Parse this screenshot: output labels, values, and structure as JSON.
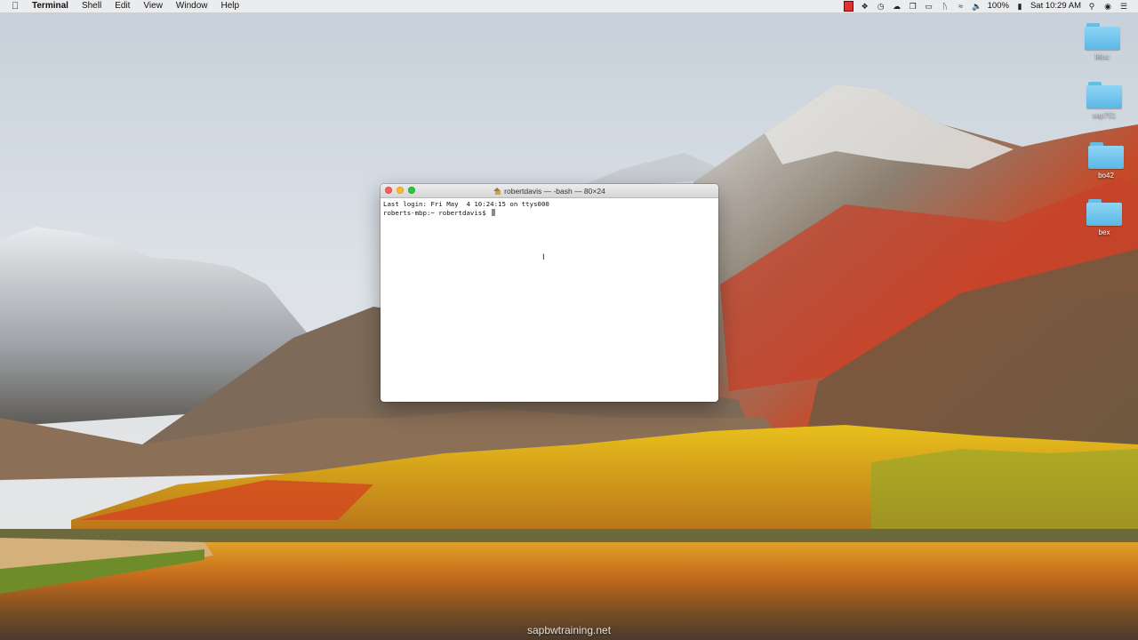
{
  "menubar": {
    "apple": "",
    "app_name": "Terminal",
    "menus": [
      "Shell",
      "Edit",
      "View",
      "Window",
      "Help"
    ],
    "battery_percent": "100%",
    "datetime": "Sat 10:29 AM",
    "icons": [
      "red-status-icon",
      "dropbox-icon",
      "time-machine-icon",
      "creative-cloud-icon",
      "screen-mirror-icon",
      "airplay-icon",
      "bluetooth-icon",
      "wifi-icon",
      "volume-icon",
      "battery-icon",
      "spotlight-icon",
      "siri-icon",
      "notification-center-icon"
    ]
  },
  "desktop": {
    "icons": [
      {
        "label": "Misc"
      },
      {
        "label": "sap751"
      },
      {
        "label": "bo42"
      },
      {
        "label": "bex"
      }
    ]
  },
  "terminal": {
    "title": "robertdavis — -bash — 80×24",
    "lines": [
      "Last login: Fri May  4 10:24:15 on ttys000",
      "roberts-mbp:~ robertdavis$ "
    ],
    "ibeam": "I"
  },
  "watermark": "sapbwtraining.net"
}
